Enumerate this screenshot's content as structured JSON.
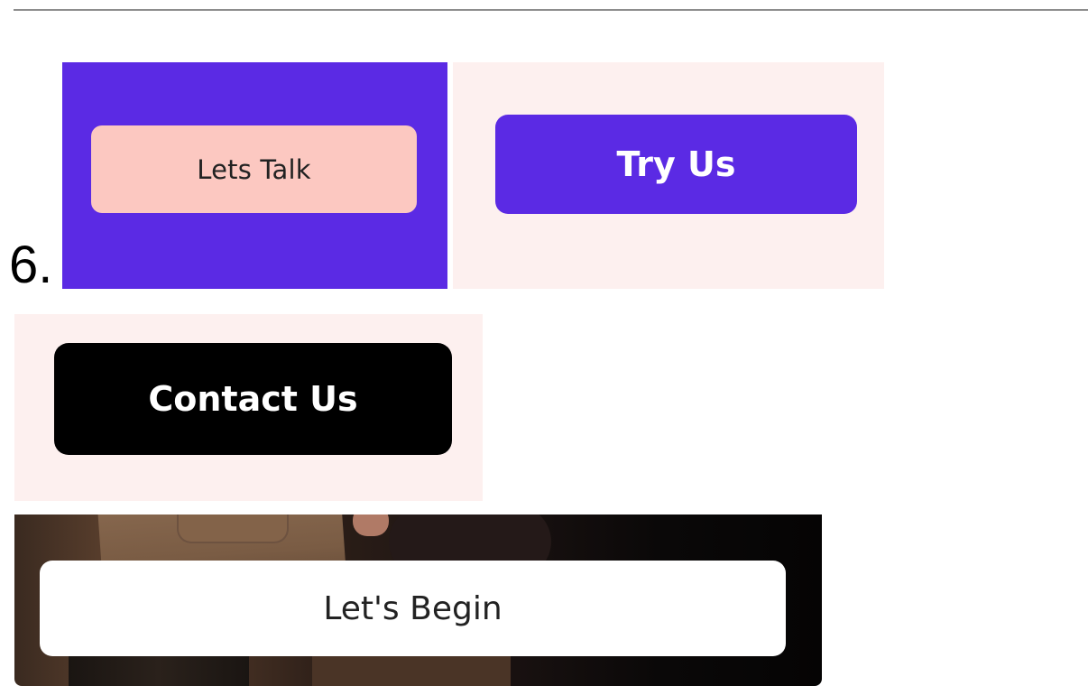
{
  "item_number": "6.",
  "colors": {
    "purple": "#5b2ae4",
    "blush": "#fdf0ef",
    "peach": "#fcc8c1",
    "black": "#000000",
    "white": "#ffffff",
    "dark_text": "#222222"
  },
  "buttons": {
    "lets_talk": {
      "label": "Lets Talk"
    },
    "try_us": {
      "label": "Try Us"
    },
    "contact_us": {
      "label": "Contact Us"
    },
    "lets_begin": {
      "label": "Let's Begin"
    }
  }
}
